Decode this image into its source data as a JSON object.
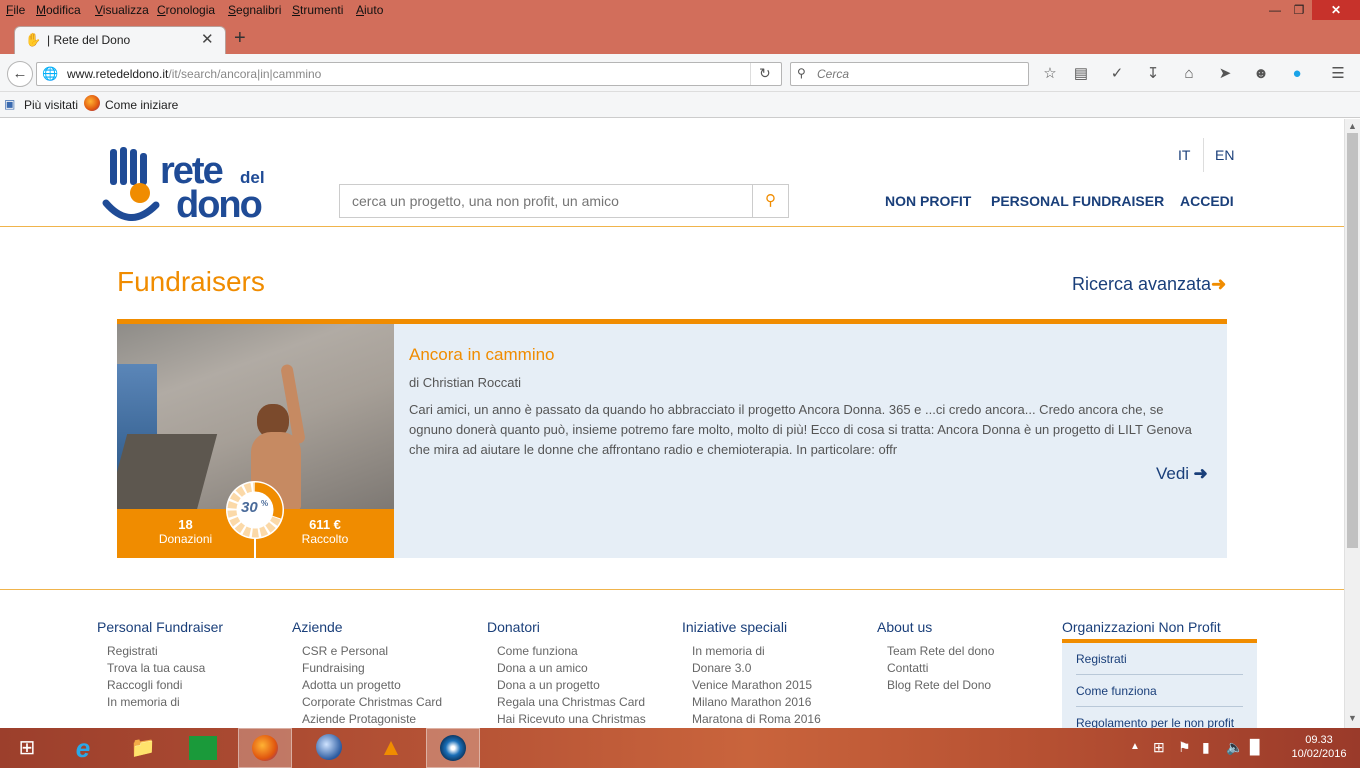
{
  "menubar": {
    "items": [
      "File",
      "Modifica",
      "Visualizza",
      "Cronologia",
      "Segnalibri",
      "Strumenti",
      "Aiuto"
    ]
  },
  "tab": {
    "title": "| Rete del Dono"
  },
  "url": {
    "domain": "www.retedeldono.it",
    "path": "/it/search/ancora|in|cammino"
  },
  "search": {
    "placeholder": "Cerca"
  },
  "bookmarks": {
    "items": [
      "Più visitati",
      "Come iniziare"
    ]
  },
  "site": {
    "lang": [
      "IT",
      "EN"
    ],
    "search_placeholder": "cerca un progetto, una non profit, un amico",
    "nav": [
      "NON PROFIT",
      "PERSONAL FUNDRAISER",
      "ACCEDI"
    ]
  },
  "main": {
    "heading": "Fundraisers",
    "advanced": "Ricerca avanzata",
    "card": {
      "title": "Ancora in cammino",
      "author": "di Christian Roccati",
      "desc": "Cari amici, un anno è passato da quando ho abbracciato il progetto Ancora Donna. 365 e ...ci credo ancora... Credo ancora che, se ognuno donerà quanto può, insieme potremo fare molto, molto di più! Ecco di cosa si tratta: Ancora Donna è un progetto di LILT Genova che mira ad aiutare le donne che affrontano radio e chemioterapia. In particolare:  offr",
      "more": "Vedi",
      "donations_count": "18",
      "donations_label": "Donazioni",
      "raised_amount": "611 €",
      "raised_label": "Raccolto",
      "progress_label": "30",
      "progress_pct": 30
    }
  },
  "footer": {
    "columns": [
      {
        "title": "Personal Fundraiser",
        "links": [
          "Registrati",
          "Trova la tua causa",
          "Raccogli fondi",
          "In memoria di"
        ]
      },
      {
        "title": "Aziende",
        "links": [
          "CSR e Personal",
          "Fundraising",
          "Adotta un progetto",
          "Corporate Christmas Card",
          "Aziende Protagoniste"
        ]
      },
      {
        "title": "Donatori",
        "links": [
          "Come funziona",
          "Dona a un amico",
          "Dona a un progetto",
          "Regala una Christmas Card",
          "Hai Ricevuto una Christmas"
        ]
      },
      {
        "title": "Iniziative speciali",
        "links": [
          "In memoria di",
          "Donare 3.0",
          "Venice Marathon 2015",
          "Milano Marathon 2016",
          "Maratona di Roma 2016"
        ]
      },
      {
        "title": "About us",
        "links": [
          "Team Rete del dono",
          "Contatti",
          "Blog Rete del Dono"
        ]
      }
    ],
    "np_title": "Organizzazioni Non Profit",
    "np_links": [
      "Registrati",
      "Come funziona",
      "Regolamento per le non profit"
    ]
  },
  "clock": {
    "time": "09.33",
    "date": "10/02/2016"
  },
  "colors": {
    "accent": "#f08c00",
    "navy": "#1a3f7a",
    "chrome": "#d26e5b"
  }
}
